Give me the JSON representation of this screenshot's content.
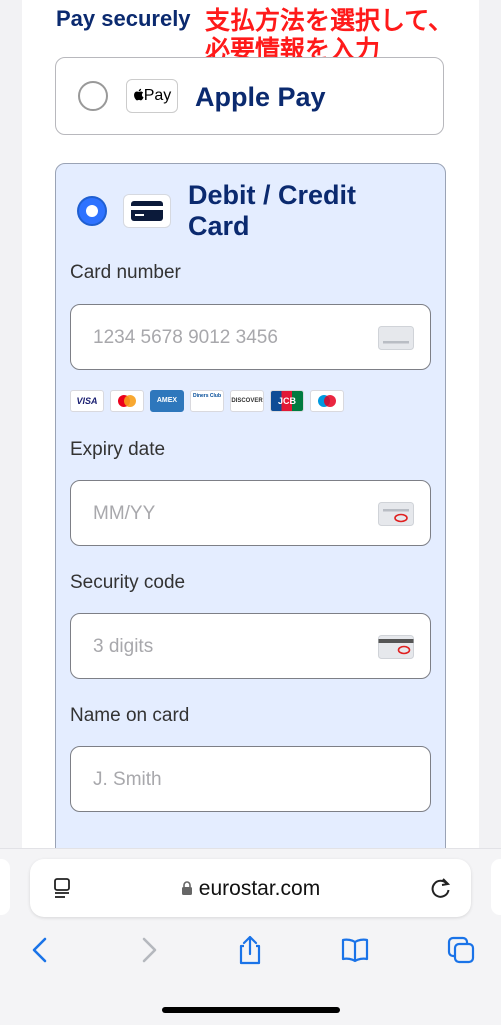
{
  "page": {
    "heading": "Pay securely",
    "annotation": "支払方法を選択して、\n必要情報を入力"
  },
  "apple_pay": {
    "badge": "Pay",
    "title": "Apple Pay"
  },
  "card_option": {
    "title": "Debit / Credit\nCard",
    "card_number": {
      "label": "Card number",
      "placeholder": "1234 5678 9012 3456"
    },
    "expiry": {
      "label": "Expiry date",
      "placeholder": "MM/YY"
    },
    "security": {
      "label": "Security code",
      "placeholder": "3 digits"
    },
    "name": {
      "label": "Name on card",
      "placeholder": "J. Smith"
    },
    "brands": [
      "VISA",
      "mastercard",
      "AMEX",
      "Diners Club",
      "DISCOVER",
      "JCB",
      "maestro"
    ]
  },
  "browser": {
    "url": "eurostar.com"
  },
  "colors": {
    "brand_navy": "#0b2a6f",
    "selected_bg": "#e4edff",
    "radio_blue": "#2e72ff",
    "annotation_red": "#ff1a1a",
    "ios_blue": "#1a73e8"
  }
}
